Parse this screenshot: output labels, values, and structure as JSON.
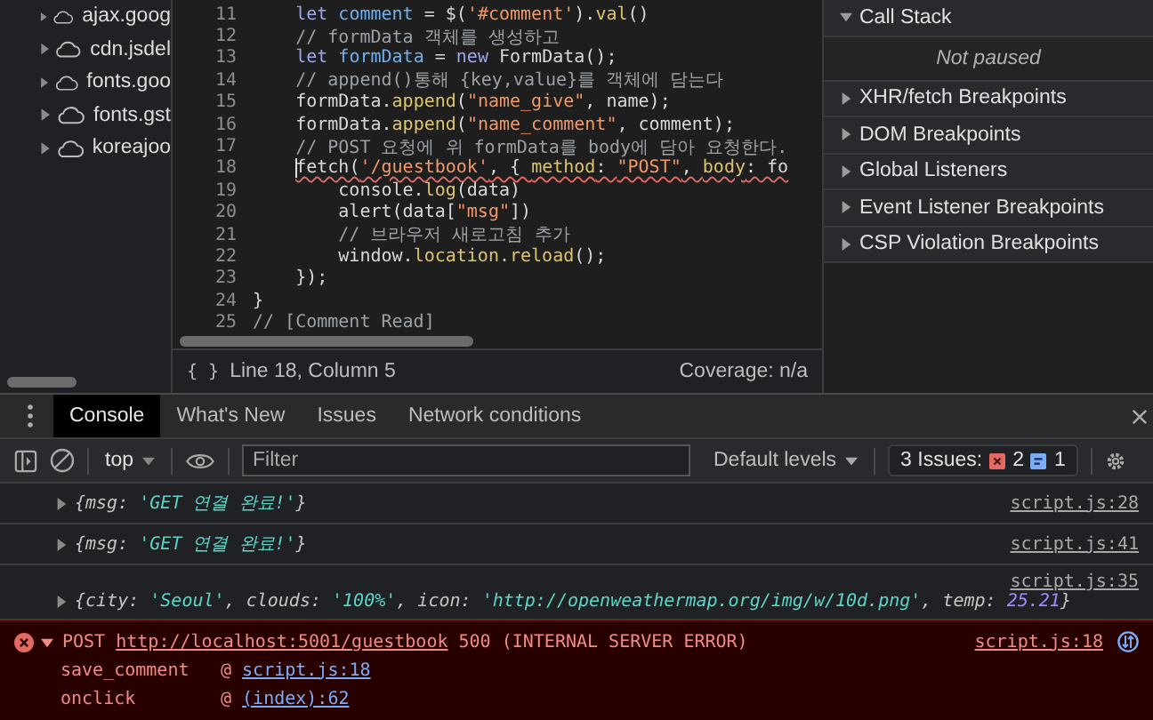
{
  "sidebar": {
    "items": [
      {
        "label": "ajax.goog",
        "expanded": false
      },
      {
        "label": "cdn.jsdel",
        "expanded": false
      },
      {
        "label": "fonts.goo",
        "expanded": false
      },
      {
        "label": "fonts.gst",
        "expanded": false
      },
      {
        "label": "koreajoo",
        "expanded": false
      }
    ]
  },
  "editor": {
    "lines": [
      {
        "number": "11",
        "error": false,
        "cursor": false,
        "tokens": [
          {
            "kind": "keyword",
            "text": "    let"
          },
          {
            "kind": "variable",
            "text": " comment"
          },
          {
            "kind": "plain",
            "text": " = $("
          },
          {
            "kind": "string",
            "text": "'#comment'"
          },
          {
            "kind": "plain",
            "text": ")."
          },
          {
            "kind": "method",
            "text": "val"
          },
          {
            "kind": "plain",
            "text": "()"
          }
        ]
      },
      {
        "number": "12",
        "error": false,
        "cursor": false,
        "tokens": [
          {
            "kind": "comment",
            "text": "    // formData 객체를 생성하고"
          }
        ]
      },
      {
        "number": "13",
        "error": false,
        "cursor": false,
        "tokens": [
          {
            "kind": "keyword",
            "text": "    let"
          },
          {
            "kind": "variable",
            "text": " formData"
          },
          {
            "kind": "plain",
            "text": " = "
          },
          {
            "kind": "keyword",
            "text": "new"
          },
          {
            "kind": "plain",
            "text": " FormData();"
          }
        ]
      },
      {
        "number": "14",
        "error": false,
        "cursor": false,
        "tokens": [
          {
            "kind": "comment",
            "text": "    // append()통해 {key,value}를 객체에 담는다"
          }
        ]
      },
      {
        "number": "15",
        "error": false,
        "cursor": false,
        "tokens": [
          {
            "kind": "plain",
            "text": "    formData."
          },
          {
            "kind": "method",
            "text": "append"
          },
          {
            "kind": "plain",
            "text": "("
          },
          {
            "kind": "string",
            "text": "\"name_give\""
          },
          {
            "kind": "plain",
            "text": ", name);"
          }
        ]
      },
      {
        "number": "16",
        "error": false,
        "cursor": false,
        "tokens": [
          {
            "kind": "plain",
            "text": "    formData."
          },
          {
            "kind": "method",
            "text": "append"
          },
          {
            "kind": "plain",
            "text": "("
          },
          {
            "kind": "string",
            "text": "\"name_comment\""
          },
          {
            "kind": "plain",
            "text": ", comment);"
          }
        ]
      },
      {
        "number": "17",
        "error": false,
        "cursor": false,
        "tokens": [
          {
            "kind": "comment",
            "text": "    // POST 요청에 위 formData를 body에 담아 요청한다."
          }
        ]
      },
      {
        "number": "18",
        "error": true,
        "cursor": true,
        "tokens": [
          {
            "kind": "plain",
            "text": "fetch("
          },
          {
            "kind": "string",
            "text": "'/guestbook'"
          },
          {
            "kind": "plain",
            "text": ", { "
          },
          {
            "kind": "method",
            "text": "method"
          },
          {
            "kind": "plain",
            "text": ": "
          },
          {
            "kind": "string",
            "text": "\"POST\""
          },
          {
            "kind": "plain",
            "text": ", "
          },
          {
            "kind": "method",
            "text": "body"
          },
          {
            "kind": "plain",
            "text": ": fo"
          }
        ]
      },
      {
        "number": "19",
        "error": false,
        "cursor": false,
        "tokens": [
          {
            "kind": "plain",
            "text": "        console."
          },
          {
            "kind": "method",
            "text": "log"
          },
          {
            "kind": "plain",
            "text": "(data)"
          }
        ]
      },
      {
        "number": "20",
        "error": false,
        "cursor": false,
        "tokens": [
          {
            "kind": "plain",
            "text": "        alert(data["
          },
          {
            "kind": "string",
            "text": "\"msg\""
          },
          {
            "kind": "plain",
            "text": "])"
          }
        ]
      },
      {
        "number": "21",
        "error": false,
        "cursor": false,
        "tokens": [
          {
            "kind": "comment",
            "text": "        // 브라우저 새로고침 추가"
          }
        ]
      },
      {
        "number": "22",
        "error": false,
        "cursor": false,
        "tokens": [
          {
            "kind": "plain",
            "text": "        window."
          },
          {
            "kind": "method",
            "text": "location.reload"
          },
          {
            "kind": "plain",
            "text": "();"
          }
        ]
      },
      {
        "number": "23",
        "error": false,
        "cursor": false,
        "tokens": [
          {
            "kind": "plain",
            "text": "    });"
          }
        ]
      },
      {
        "number": "24",
        "error": false,
        "cursor": false,
        "tokens": [
          {
            "kind": "plain",
            "text": "}"
          }
        ]
      },
      {
        "number": "25",
        "error": false,
        "cursor": false,
        "tokens": [
          {
            "kind": "comment",
            "text": "// [Comment Read]"
          }
        ]
      }
    ],
    "status": {
      "format": "{ }",
      "position": "Line 18, Column 5",
      "coverage": "Coverage: n/a"
    }
  },
  "debugger": {
    "sections": [
      {
        "title": "Call Stack",
        "expanded": true,
        "content": "Not paused"
      },
      {
        "title": "XHR/fetch Breakpoints",
        "expanded": false
      },
      {
        "title": "DOM Breakpoints",
        "expanded": false
      },
      {
        "title": "Global Listeners",
        "expanded": false
      },
      {
        "title": "Event Listener Breakpoints",
        "expanded": false
      },
      {
        "title": "CSP Violation Breakpoints",
        "expanded": false
      }
    ]
  },
  "drawer": {
    "tabs": [
      {
        "label": "Console",
        "selected": true
      },
      {
        "label": "What's New",
        "selected": false
      },
      {
        "label": "Issues",
        "selected": false
      },
      {
        "label": "Network conditions",
        "selected": false
      }
    ],
    "toolbar": {
      "context": "top",
      "filter": {
        "placeholder": "Filter"
      },
      "levels": "Default levels",
      "issues": {
        "label": "3 Issues:",
        "errors": "2",
        "infos": "1"
      }
    },
    "messages": [
      {
        "kind": "log",
        "expanded": false,
        "source": "script.js:28",
        "parts": [
          {
            "kind": "key",
            "text": "{msg:"
          },
          {
            "kind": "string",
            "text": " 'GET 연결 완료!'"
          },
          {
            "kind": "key",
            "text": "}"
          }
        ]
      },
      {
        "kind": "log",
        "expanded": false,
        "source": "script.js:41",
        "parts": [
          {
            "kind": "key",
            "text": "{msg:"
          },
          {
            "kind": "string",
            "text": " 'GET 연결 완료!'"
          },
          {
            "kind": "key",
            "text": "}"
          }
        ]
      },
      {
        "kind": "log",
        "expanded": false,
        "source": "script.js:35",
        "parts": [
          {
            "kind": "key",
            "text": "{city:"
          },
          {
            "kind": "string",
            "text": " 'Seoul'"
          },
          {
            "kind": "key",
            "text": ", clouds:"
          },
          {
            "kind": "string",
            "text": " '100%'"
          },
          {
            "kind": "key",
            "text": ", icon:"
          },
          {
            "kind": "string",
            "text": " 'http://openweathermap.org/img/w/10d.png'"
          },
          {
            "kind": "key",
            "text": ", temp:"
          },
          {
            "kind": "number",
            "text": " 25.21"
          },
          {
            "kind": "key",
            "text": "}"
          }
        ]
      },
      {
        "kind": "error",
        "expanded": true,
        "method": "POST",
        "url": "http://localhost:5001/guestbook",
        "status": "500 (INTERNAL SERVER ERROR)",
        "source": "script.js:18",
        "stack": [
          {
            "function": "save_comment",
            "at": "@",
            "location": "script.js:18"
          },
          {
            "function": "onclick",
            "at": "@",
            "location": "(index):62"
          }
        ]
      }
    ]
  }
}
